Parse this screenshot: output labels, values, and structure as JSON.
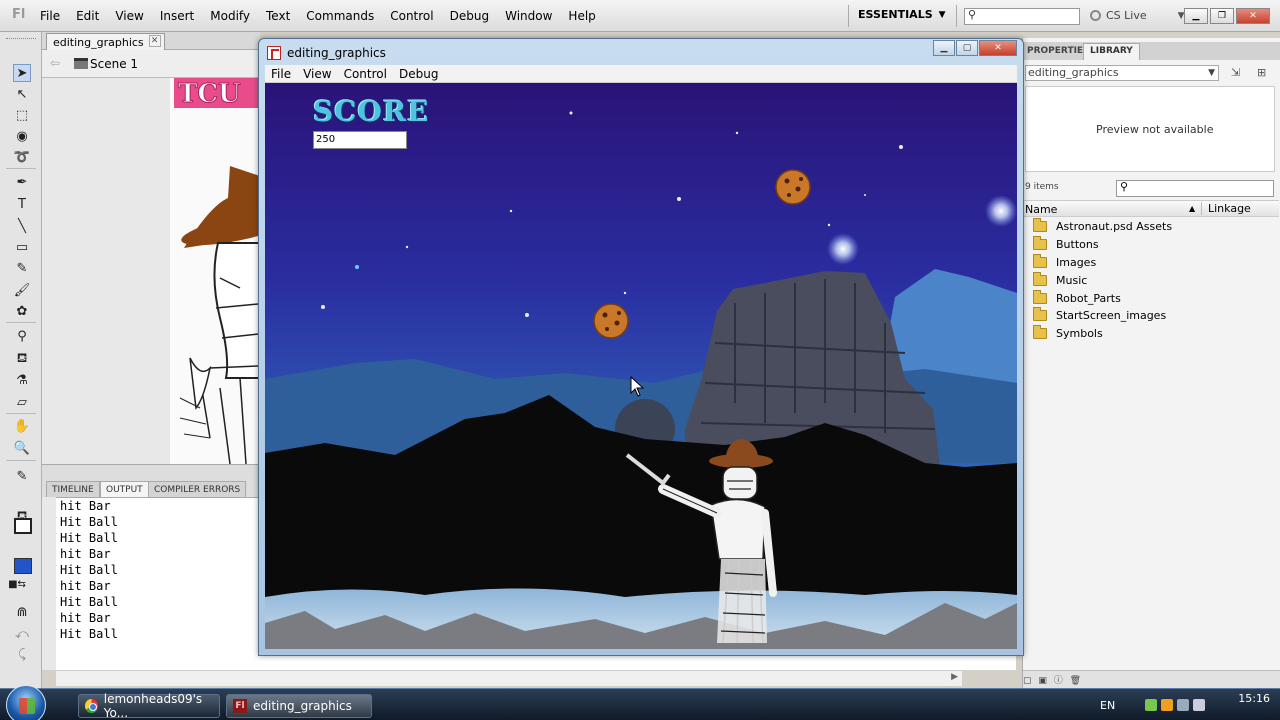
{
  "app": {
    "menu": [
      "File",
      "Edit",
      "View",
      "Insert",
      "Modify",
      "Text",
      "Commands",
      "Control",
      "Debug",
      "Window",
      "Help"
    ],
    "workspace": "ESSENTIALS",
    "cs_live": "CS Live"
  },
  "document": {
    "tab_label": "editing_graphics",
    "scene_label": "Scene 1"
  },
  "bottom_panel": {
    "tabs": [
      "TIMELINE",
      "OUTPUT",
      "COMPILER ERRORS"
    ],
    "output_lines": [
      "hit Bar",
      "Hit Ball",
      "Hit Ball",
      "hit Bar",
      "Hit Ball",
      "hit Bar",
      "Hit Ball",
      "hit Bar",
      "Hit Ball"
    ]
  },
  "library": {
    "tabs": [
      "PROPERTIES",
      "LIBRARY"
    ],
    "selected_doc": "editing_graphics",
    "preview_text": "Preview not available",
    "items_count": "9 items",
    "col_name": "Name",
    "col_linkage": "Linkage",
    "items": [
      "Astronaut.psd Assets",
      "Buttons",
      "Images",
      "Music",
      "Robot_Parts",
      "StartScreen_images",
      "Symbols"
    ]
  },
  "player": {
    "title": "editing_graphics",
    "menu": [
      "File",
      "View",
      "Control",
      "Debug"
    ],
    "score_title": "SCORE",
    "score_value": "250"
  },
  "taskbar": {
    "buttons": [
      "lemonheads09's Yo...",
      "editing_graphics"
    ],
    "lang": "EN",
    "clock": "15:16"
  }
}
